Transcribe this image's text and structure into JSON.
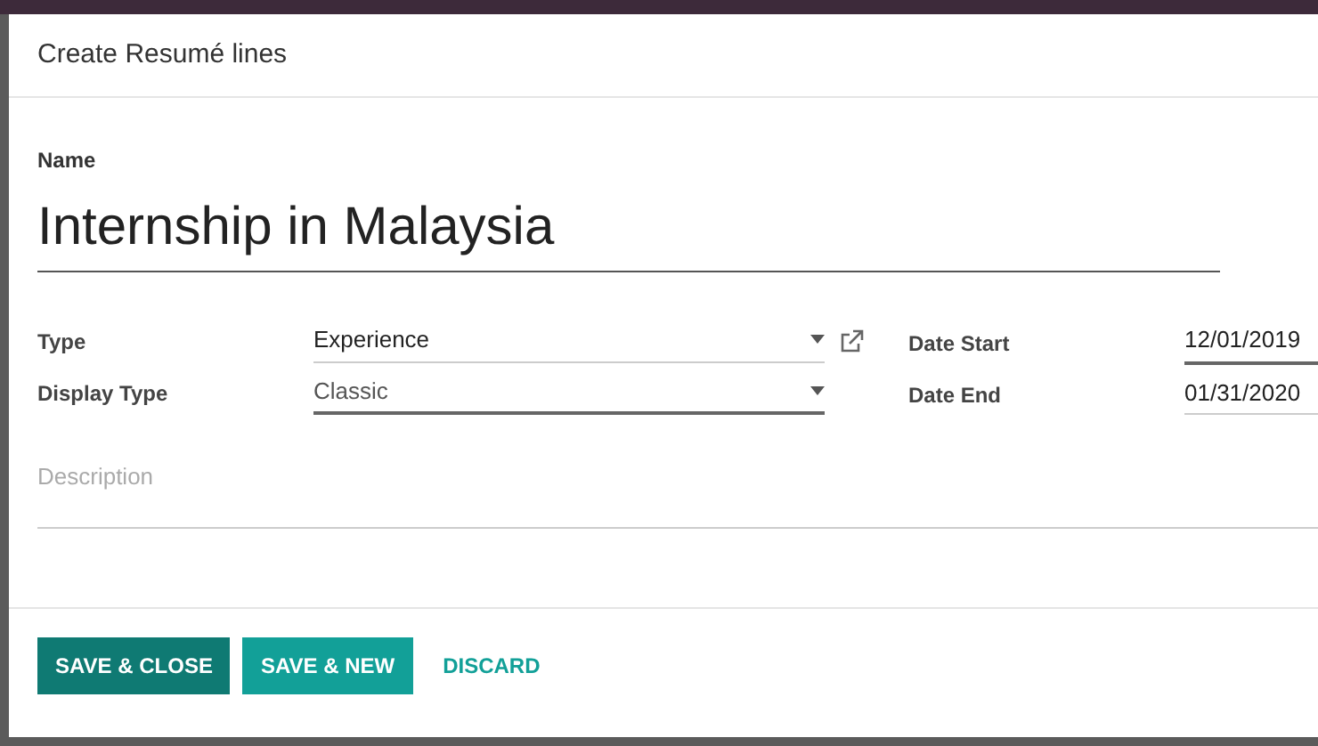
{
  "dialog": {
    "title": "Create Resumé lines"
  },
  "name_field": {
    "label": "Name",
    "value": "Internship in Malaysia"
  },
  "left_fields": [
    {
      "label": "Type",
      "value": "Experience",
      "focused": false,
      "external_link": true
    },
    {
      "label": "Display Type",
      "value": "Classic",
      "focused": true,
      "external_link": false
    }
  ],
  "right_fields": [
    {
      "label": "Date Start",
      "value": "12/01/2019",
      "focused": true
    },
    {
      "label": "Date End",
      "value": "01/31/2020",
      "focused": false
    }
  ],
  "description": {
    "placeholder": "Description"
  },
  "buttons": [
    {
      "label": "SAVE & CLOSE",
      "kind": "primary",
      "selected": true
    },
    {
      "label": "SAVE & NEW",
      "kind": "primary",
      "selected": false
    },
    {
      "label": "DISCARD",
      "kind": "link",
      "selected": false
    }
  ]
}
